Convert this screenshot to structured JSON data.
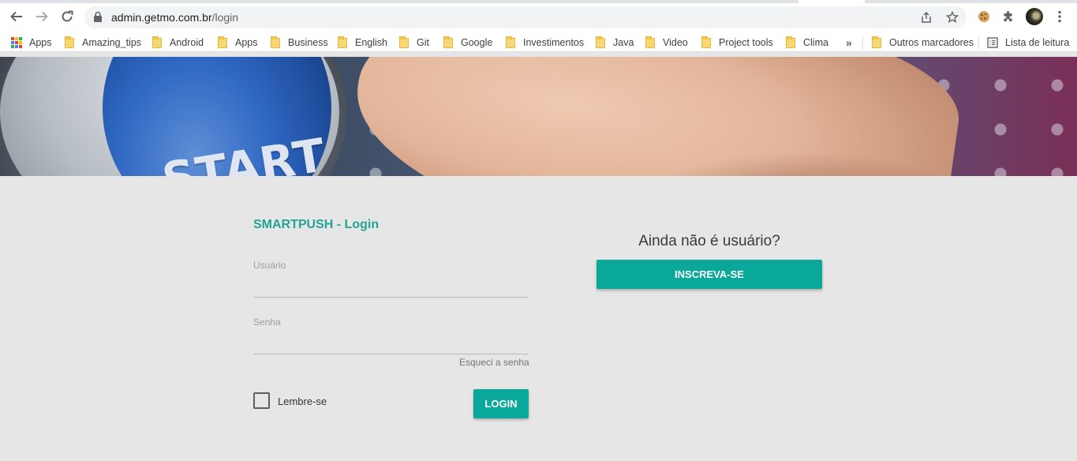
{
  "browser": {
    "url_host": "admin.getmo.com.br",
    "url_path": "/login",
    "bookmarks": [
      {
        "label": "Apps",
        "icon": "apps-grid-icon"
      },
      {
        "label": "Amazing_tips",
        "icon": "folder-icon"
      },
      {
        "label": "Android",
        "icon": "folder-icon"
      },
      {
        "label": "Apps",
        "icon": "folder-icon"
      },
      {
        "label": "Business",
        "icon": "folder-icon"
      },
      {
        "label": "English",
        "icon": "folder-icon"
      },
      {
        "label": "Git",
        "icon": "folder-icon"
      },
      {
        "label": "Google",
        "icon": "folder-icon"
      },
      {
        "label": "Investimentos",
        "icon": "folder-icon"
      },
      {
        "label": "Java",
        "icon": "folder-icon"
      },
      {
        "label": "Video",
        "icon": "folder-icon"
      },
      {
        "label": "Project tools",
        "icon": "folder-icon"
      },
      {
        "label": "Clima",
        "icon": "folder-icon"
      }
    ],
    "overflow_label": "»",
    "other_bookmarks": "Outros marcadores",
    "reading_list": "Lista de leitura"
  },
  "banner": {
    "button_text": "START"
  },
  "login": {
    "title": "SMARTPUSH - Login",
    "username_label": "Usuário",
    "username_value": "",
    "password_label": "Senha",
    "password_value": "",
    "forgot_label": "Esqueci a senha",
    "remember_label": "Lembre-se",
    "remember_checked": false,
    "submit_label": "LOGIN"
  },
  "signup": {
    "heading": "Ainda não é usuário?",
    "button_label": "INSCREVA-SE"
  },
  "colors": {
    "accent": "#0aa89b",
    "title": "#24a396",
    "page_bg": "#e5e6e5"
  }
}
